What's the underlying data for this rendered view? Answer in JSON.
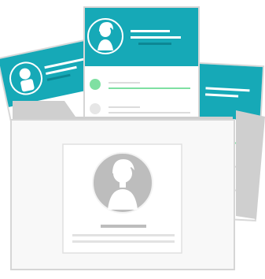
{
  "illustration": {
    "subject": "profile-cards-folder",
    "cards": [
      {
        "role": "back-left-card",
        "header_color": "#16a9b7"
      },
      {
        "role": "center-card",
        "header_color": "#16a9b7",
        "list_items": [
          {
            "state": "selected",
            "dot_color": "#7fe0a2",
            "line_color": "#7fe0a2"
          },
          {
            "state": "unselected",
            "dot_color": "#dcdcdc",
            "line_color": "#dcdcdc"
          }
        ]
      },
      {
        "role": "back-right-card",
        "header_color": "#16a9b7"
      }
    ],
    "folder": {
      "back_color": "#cfcfcf",
      "front_color": "#f8f8f8",
      "outline_color": "#d6d6d6"
    },
    "colors": {
      "teal": "#16a9b7",
      "teal_dark": "#0c8794",
      "green": "#7fe0a2",
      "avatar_gray": "#bdbdbd",
      "line_gray": "#dcdcdc",
      "white": "#ffffff"
    }
  }
}
